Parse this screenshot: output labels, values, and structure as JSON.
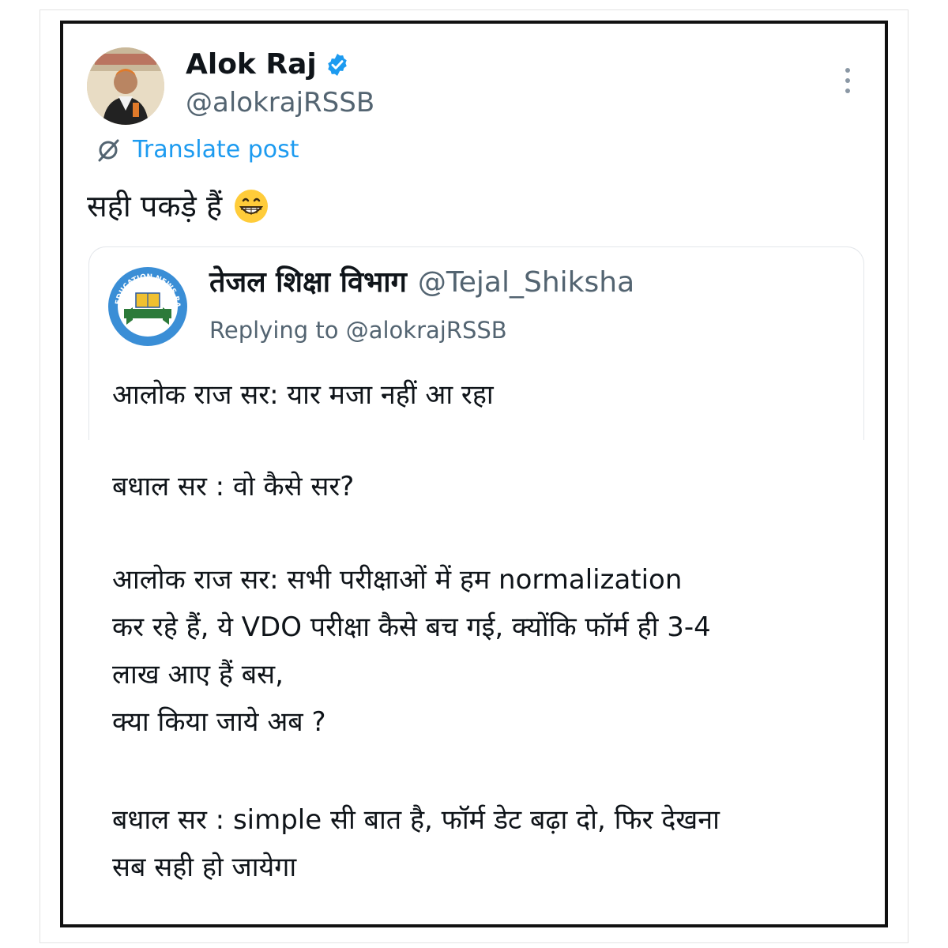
{
  "author": {
    "name": "Alok Raj",
    "handle": "@alokrajRSSB",
    "verified": true,
    "avatar_icon": "profile-photo"
  },
  "more_icon": "more-vertical-icon",
  "translate": {
    "label": "Translate post",
    "icon": "translate-icon"
  },
  "post": {
    "text": "सही पकड़े हैं",
    "emoji": "grinning-face-emoji"
  },
  "quote": {
    "name": "तेजल शिक्षा विभाग",
    "handle": "@Tejal_Shiksha",
    "avatar_icon": "education-news-rajasthan-logo",
    "replying": "Replying to @alokrajRSSB",
    "lines": [
      "आलोक राज सर: यार मजा नहीं आ रहा",
      "बधाल सर : वो कैसे सर?",
      "आलोक राज सर: सभी परीक्षाओं में हम normalization",
      "कर रहे हैं,  ये VDO परीक्षा कैसे बच गई, क्योंकि फॉर्म ही 3-4",
      "लाख आए हैं बस,",
      "क्या किया जाये अब ?",
      "बधाल सर : simple सी बात है,  फॉर्म डेट बढ़ा दो, फिर देखना",
      "सब सही हो जायेगा"
    ]
  },
  "colors": {
    "text": "#0f1419",
    "secondary": "#536471",
    "link": "#1d9bf0",
    "frame_border": "#111111"
  },
  "logo_text": "EDUCATION NEWS RAJASTHAN"
}
